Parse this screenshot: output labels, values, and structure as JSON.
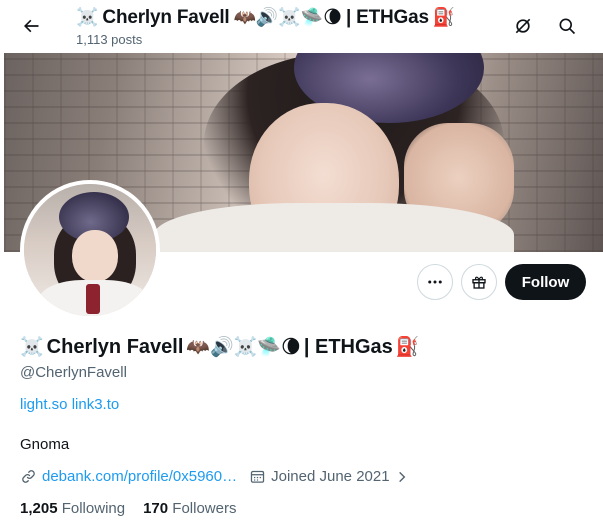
{
  "header": {
    "title_prefix": "☠️",
    "title_name": "Cherlyn Favell",
    "title_emojis": "🦇🔊☠️🛸🌘",
    "title_suffix": "| ETHGas",
    "title_tail_emoji": "⛽",
    "post_count": "1,113 posts",
    "back_icon": "arrow-left-icon",
    "grok_icon": "grok-icon",
    "search_icon": "search-icon"
  },
  "profile": {
    "name_prefix": "☠️",
    "name": "Cherlyn Favell",
    "name_emojis": "🦇🔊☠️🛸🌘",
    "name_suffix": "| ETHGas",
    "name_tail_emoji": "⛽",
    "handle": "@CherlynFavell",
    "link1": "light.so",
    "link2": "link3.to",
    "bio": "Gnoma",
    "website": "debank.com/profile/0x5960…",
    "joined": "Joined June 2021",
    "following_count": "1,205",
    "following_label": "Following",
    "followers_count": "170",
    "followers_label": "Followers"
  },
  "actions": {
    "more_icon": "more-icon",
    "gift_icon": "gift-icon",
    "follow_label": "Follow"
  },
  "colors": {
    "text": "#0f1419",
    "secondary": "#536471",
    "link": "#1d9bf0",
    "follow_bg": "#0f1419"
  }
}
